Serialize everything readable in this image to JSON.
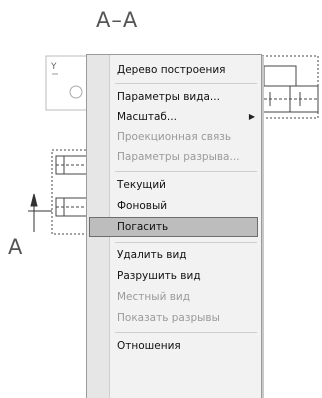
{
  "drawing": {
    "section_title": "А–А",
    "view_label": "А"
  },
  "menu": {
    "items": [
      {
        "label": "Дерево построения",
        "disabled": false
      },
      {
        "label": "Параметры вида...",
        "disabled": false
      },
      {
        "label": "Масштаб...",
        "disabled": false,
        "submenu": true
      },
      {
        "label": "Проекционная связь",
        "disabled": true
      },
      {
        "label": "Параметры разрыва...",
        "disabled": true
      },
      {
        "label": "Текущий",
        "disabled": false
      },
      {
        "label": "Фоновый",
        "disabled": false
      },
      {
        "label": "Погасить",
        "disabled": false,
        "highlighted": true
      },
      {
        "label": "Удалить вид",
        "disabled": false
      },
      {
        "label": "Разрушить вид",
        "disabled": false
      },
      {
        "label": "Местный вид",
        "disabled": true
      },
      {
        "label": "Показать разрывы",
        "disabled": true
      },
      {
        "label": "Отношения",
        "disabled": false
      }
    ],
    "submenu_arrow": "▶"
  }
}
